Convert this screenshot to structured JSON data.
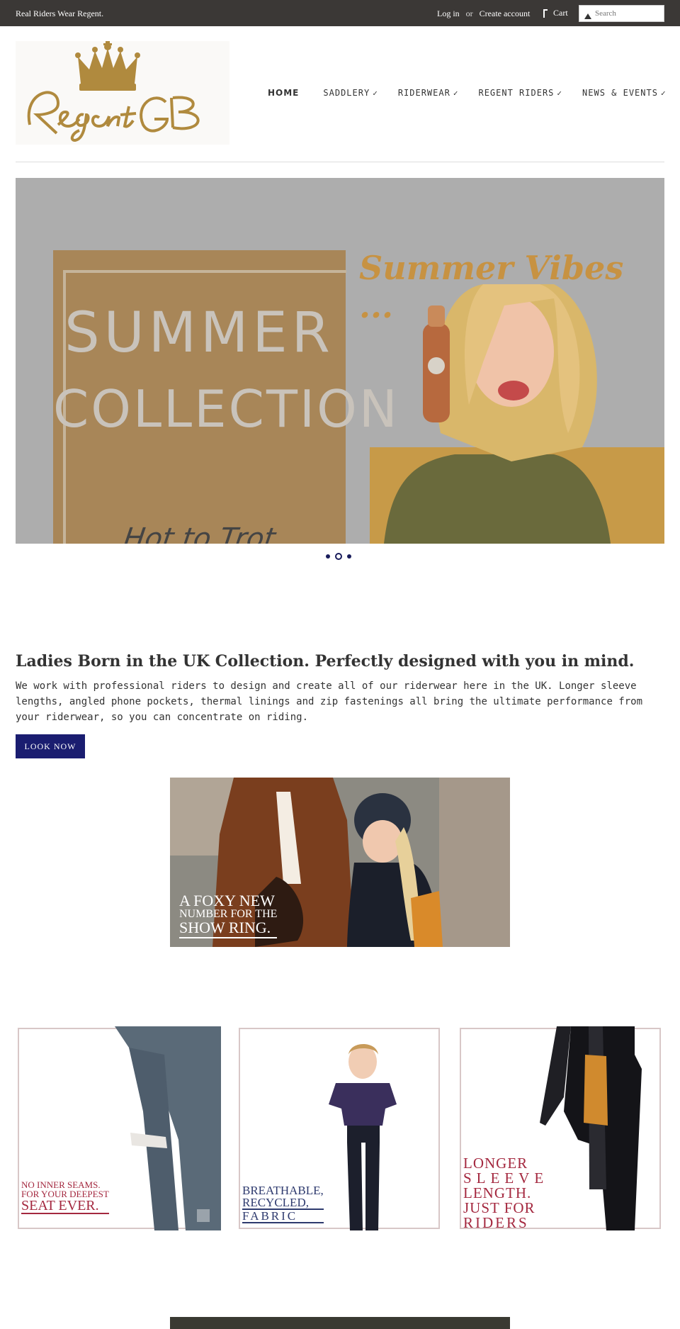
{
  "topbar": {
    "tagline": "Real Riders Wear Regent.",
    "login": "Log in",
    "or": "or",
    "create_account": "Create account",
    "cart": "Cart",
    "search_placeholder": "Search"
  },
  "logo": {
    "text": "Regent GB"
  },
  "nav": {
    "items": [
      {
        "label": "HOME"
      },
      {
        "label": "SADDLERY"
      },
      {
        "label": "RIDERWEAR"
      },
      {
        "label": "REGENT RIDERS"
      },
      {
        "label": "NEWS & EVENTS"
      }
    ]
  },
  "hero": {
    "line1": "SUMMER",
    "line2": "COLLECTION",
    "line3": "Hot to Trot",
    "vibes": "Summer Vibes ...",
    "slides": 3,
    "active_slide": 2
  },
  "intro": {
    "title": "Ladies Born in the UK Collection. Perfectly designed with you in mind.",
    "text": "We work with professional riders to design and create all of our riderwear here in the UK. Longer sleeve lengths, angled phone pockets, thermal linings and zip fastenings all bring the ultimate performance from your riderwear, so you can concentrate on riding.",
    "button": "LOOK NOW"
  },
  "feature": {
    "line1": "A FOXY NEW",
    "line2": "NUMBER FOR THE",
    "line3": "SHOW RING."
  },
  "cards": [
    {
      "lines": [
        "NO INNER SEAMS.",
        "FOR YOUR DEEPEST",
        "SEAT EVER."
      ]
    },
    {
      "lines": [
        "BREATHABLE,",
        "RECYCLED,",
        "FABRIC"
      ]
    },
    {
      "lines": [
        "LONGER",
        "SLEEVE",
        "LENGTH.",
        "JUST FOR",
        "RIDERS"
      ]
    }
  ],
  "colors": {
    "topbar": "#3b3836",
    "brand_gold": "#b08a3e",
    "button_navy": "#1a1d70",
    "card_caption_red": "#a4283f",
    "card_caption_navy": "#2e3a6e"
  }
}
